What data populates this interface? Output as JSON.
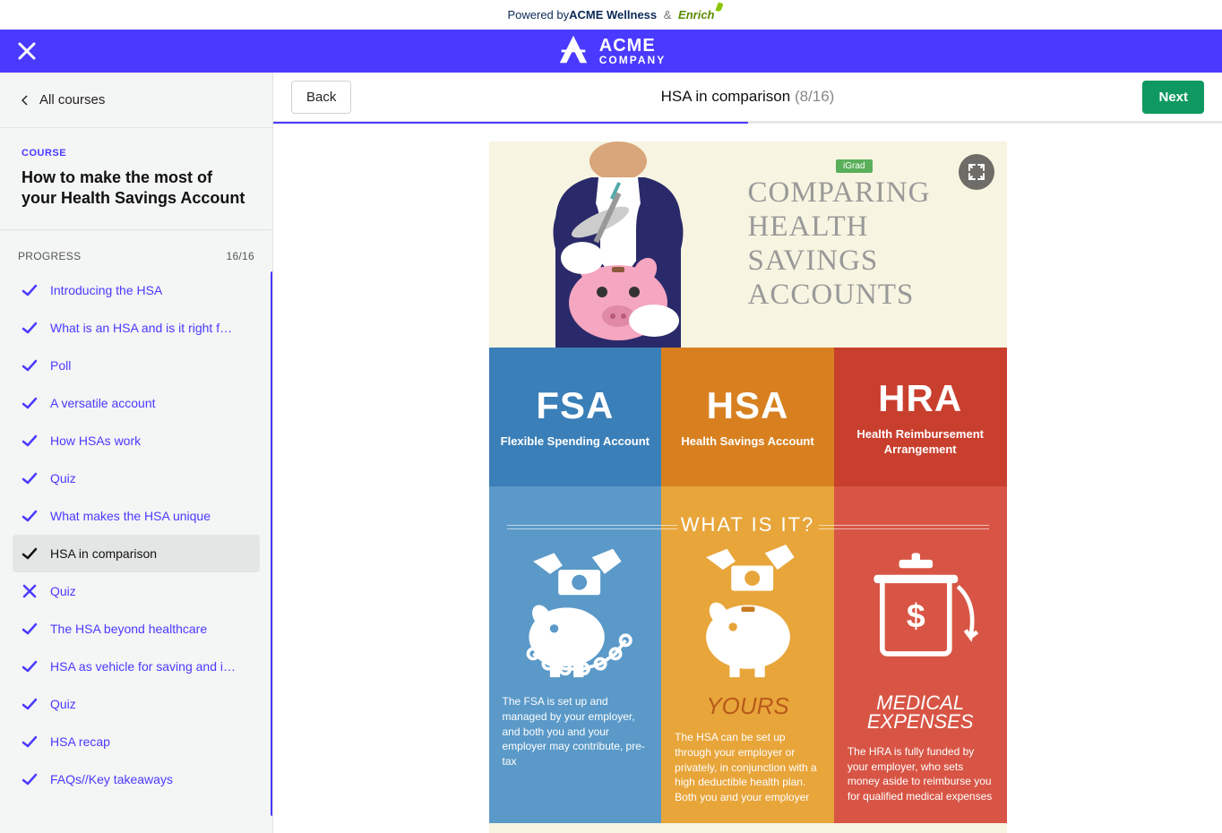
{
  "powered": {
    "prefix": "Powered by ",
    "wellness": "ACME Wellness",
    "enrich": "Enrich"
  },
  "brand": {
    "line1": "ACME",
    "line2": "COMPANY"
  },
  "sidebar": {
    "all_courses": "All courses",
    "course_label": "COURSE",
    "course_title": "How to make the most of your Health Savings Account",
    "progress_label": "PROGRESS",
    "progress_value": "16/16",
    "lessons": [
      {
        "label": "Introducing the HSA",
        "state": "check"
      },
      {
        "label": "What is an HSA and is it right for m...",
        "state": "check"
      },
      {
        "label": "Poll",
        "state": "check"
      },
      {
        "label": "A versatile account",
        "state": "check"
      },
      {
        "label": "How HSAs work",
        "state": "check"
      },
      {
        "label": "Quiz",
        "state": "check"
      },
      {
        "label": "What makes the HSA unique",
        "state": "check"
      },
      {
        "label": "HSA in comparison",
        "state": "check",
        "active": true
      },
      {
        "label": "Quiz",
        "state": "cross"
      },
      {
        "label": "The HSA beyond healthcare",
        "state": "check"
      },
      {
        "label": "HSA as vehicle for saving and inves...",
        "state": "check"
      },
      {
        "label": "Quiz",
        "state": "check"
      },
      {
        "label": "HSA recap",
        "state": "check"
      },
      {
        "label": "FAQs//Key takeaways",
        "state": "check"
      }
    ]
  },
  "header": {
    "back": "Back",
    "next": "Next",
    "title": "HSA in comparison",
    "counter": "(8/16)"
  },
  "infographic": {
    "igrad": "iGrad",
    "heading": "COMPARING HEALTH SAVINGS ACCOUNTS",
    "cols": {
      "fsa": {
        "abbr": "FSA",
        "full": "Flexible Spending Account"
      },
      "hsa": {
        "abbr": "HSA",
        "full": "Health Savings Account"
      },
      "hra": {
        "abbr": "HRA",
        "full": "Health Reimbursement Arrangement"
      }
    },
    "what_banner": "WHAT IS IT?",
    "yours": "YOURS",
    "medex_l1": "MEDICAL",
    "medex_l2": "EXPENSES",
    "desc": {
      "fsa": "The FSA is set up and managed by your employer, and both you and your employer may contribute, pre-tax",
      "hsa": "The HSA can be set up through your employer or privately, in conjunction with a high deductible health plan. Both you and your employer",
      "hra": "The HRA is fully funded by your employer, who sets money aside to reimburse you for qualified medical expenses"
    }
  }
}
